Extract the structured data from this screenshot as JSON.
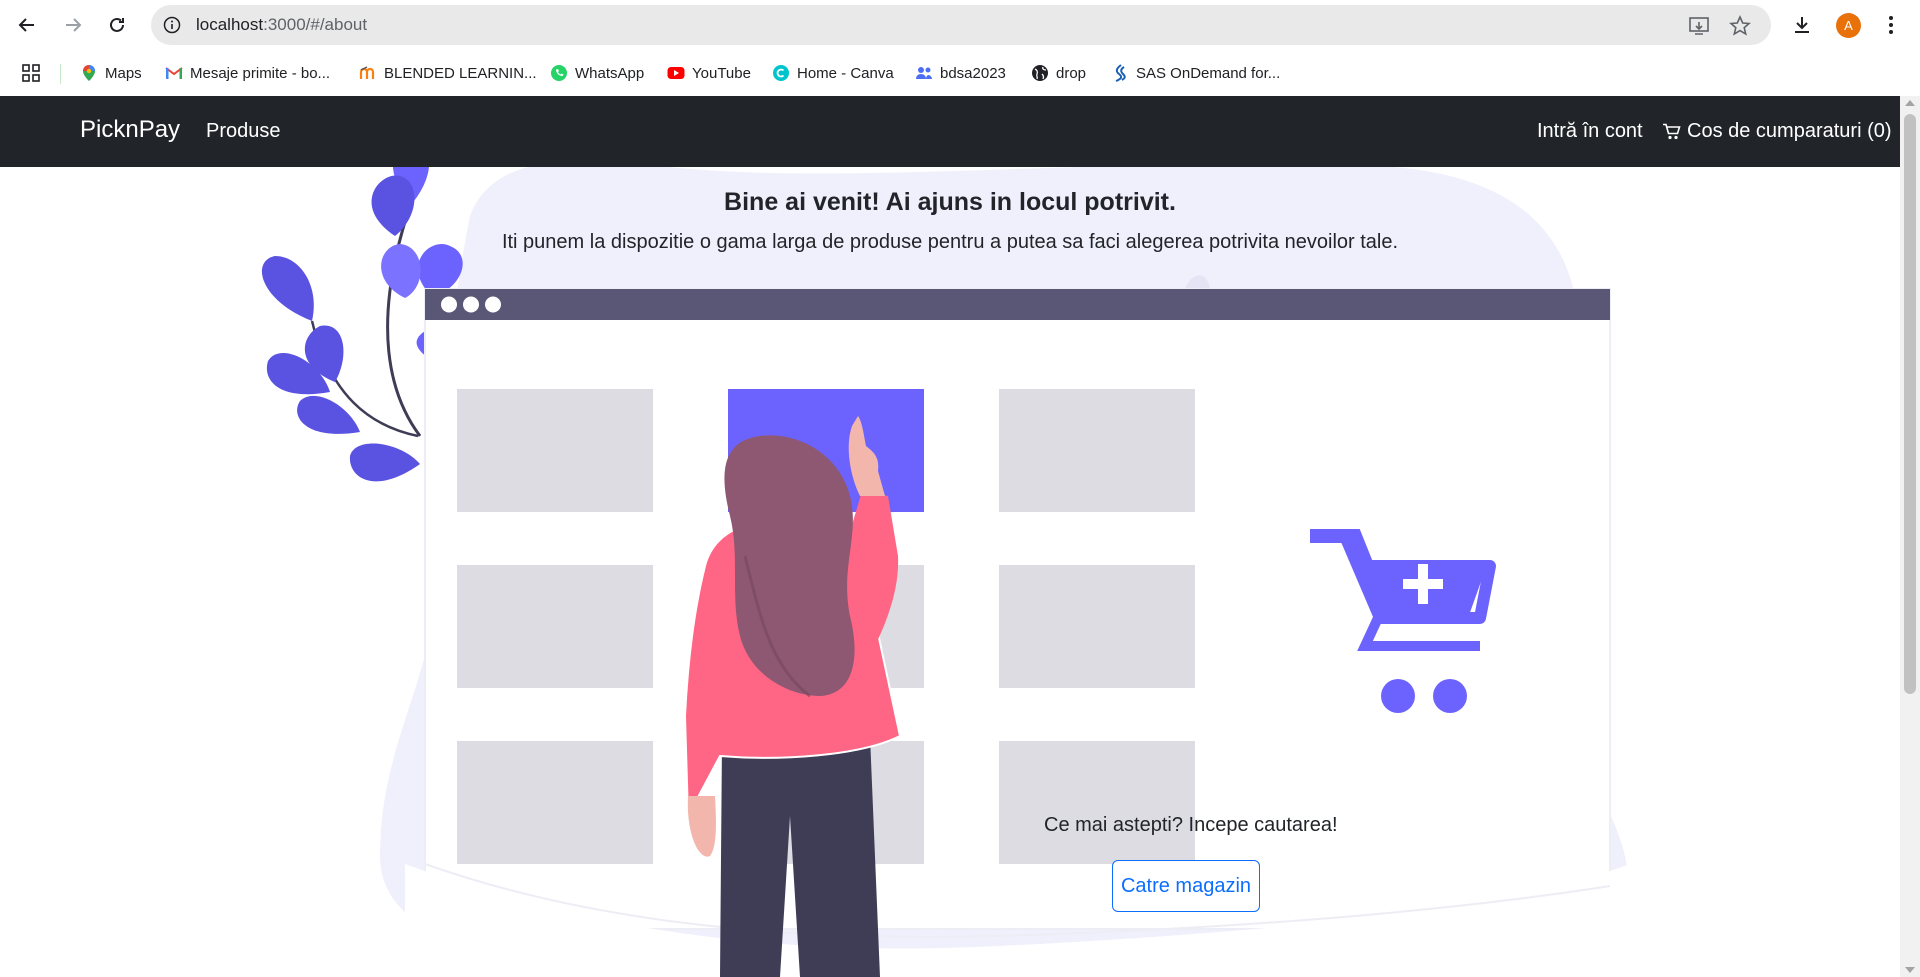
{
  "browser": {
    "url_host": "localhost",
    "url_path": ":3000/#/about",
    "avatar_letter": "A"
  },
  "bookmarks": [
    {
      "label": "Maps",
      "icon": "maps-pin-icon"
    },
    {
      "label": "Mesaje primite - bo...",
      "icon": "gmail-icon"
    },
    {
      "label": "BLENDED LEARNIN...",
      "icon": "moodle-icon"
    },
    {
      "label": "WhatsApp",
      "icon": "whatsapp-icon"
    },
    {
      "label": "YouTube",
      "icon": "youtube-icon"
    },
    {
      "label": "Home - Canva",
      "icon": "canva-icon"
    },
    {
      "label": "bdsa2023",
      "icon": "people-icon"
    },
    {
      "label": "drop",
      "icon": "globe-icon"
    },
    {
      "label": "SAS OnDemand for...",
      "icon": "sas-icon"
    }
  ],
  "navbar": {
    "brand": "PicknPay",
    "products": "Produse",
    "login": "Intră în cont",
    "cart": "Cos de cumparaturi (0)"
  },
  "hero": {
    "headline": "Bine ai venit! Ai ajuns in locul potrivit.",
    "subline": "Iti punem la dispozitie o gama larga de produse pentru a putea sa faci alegerea potrivita nevoilor tale.",
    "cta_text": "Ce mai astepti? Incepe cautarea!",
    "cta_button": "Catre magazin"
  },
  "colors": {
    "navbar": "#212529",
    "accent": "#6c63ff",
    "link": "#0d6efd",
    "blob": "#f0f0fc",
    "tile": "#dcdce2",
    "window_bar": "#5a5675",
    "jacket": "#ff6584",
    "hair": "#8e5872",
    "pants": "#3f3d56"
  }
}
